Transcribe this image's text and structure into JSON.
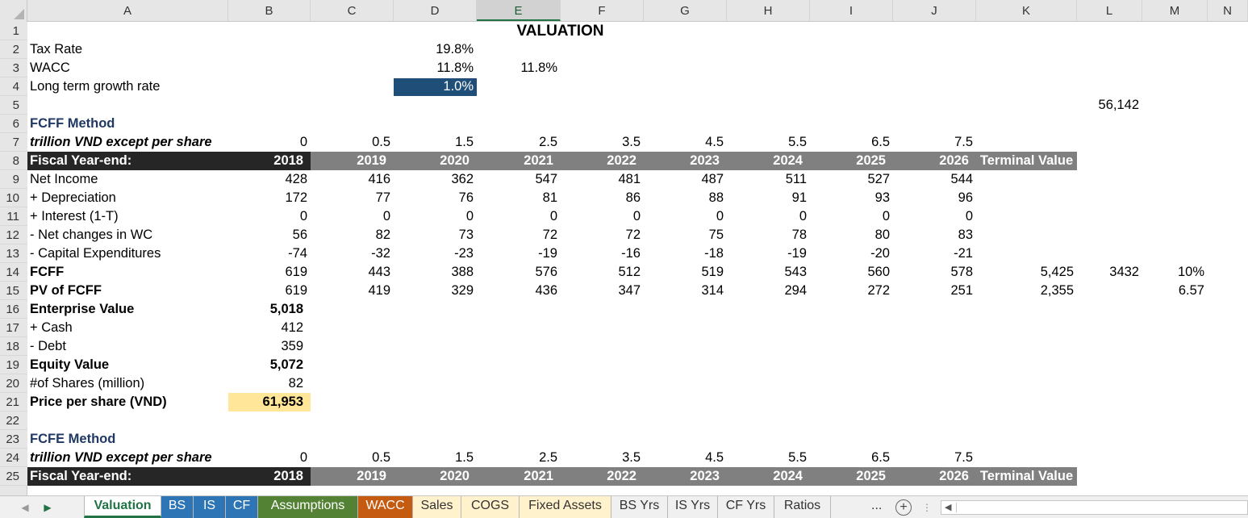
{
  "columns": [
    "A",
    "B",
    "C",
    "D",
    "E",
    "F",
    "G",
    "H",
    "I",
    "J",
    "K",
    "L",
    "M",
    "N"
  ],
  "selected_column": "E",
  "rows": [
    "1",
    "2",
    "3",
    "4",
    "5",
    "6",
    "7",
    "8",
    "9",
    "10",
    "11",
    "12",
    "13",
    "14",
    "15",
    "16",
    "17",
    "18",
    "19",
    "20",
    "21",
    "22",
    "23",
    "24",
    "25"
  ],
  "title": "VALUATION",
  "inputs": {
    "tax_rate": {
      "label": "Tax Rate",
      "value": "19.8%"
    },
    "wacc": {
      "label": "WACC",
      "value": "11.8%",
      "value2": "11.8%"
    },
    "growth": {
      "label": "Long term growth rate",
      "value": "1.0%"
    },
    "l5_value": "56,142"
  },
  "fcff": {
    "heading": "FCFF Method",
    "units": "trillion VND except per share",
    "periods": [
      "0",
      "0.5",
      "1.5",
      "2.5",
      "3.5",
      "4.5",
      "5.5",
      "6.5",
      "7.5"
    ],
    "header_label": "Fiscal Year-end:",
    "years": [
      "2018",
      "2019",
      "2020",
      "2021",
      "2022",
      "2023",
      "2024",
      "2025",
      "2026"
    ],
    "terminal": "Terminal Value",
    "lines": [
      {
        "label": "Net Income",
        "bold": false,
        "values": [
          "428",
          "416",
          "362",
          "547",
          "481",
          "487",
          "511",
          "527",
          "544"
        ]
      },
      {
        "label": "+ Depreciation",
        "bold": false,
        "values": [
          "172",
          "77",
          "76",
          "81",
          "86",
          "88",
          "91",
          "93",
          "96"
        ]
      },
      {
        "label": "+ Interest (1-T)",
        "bold": false,
        "values": [
          "0",
          "0",
          "0",
          "0",
          "0",
          "0",
          "0",
          "0",
          "0"
        ]
      },
      {
        "label": "- Net changes in WC",
        "bold": false,
        "values": [
          "56",
          "82",
          "73",
          "72",
          "72",
          "75",
          "78",
          "80",
          "83"
        ]
      },
      {
        "label": "- Capital Expenditures",
        "bold": false,
        "values": [
          "-74",
          "-32",
          "-23",
          "-19",
          "-16",
          "-18",
          "-19",
          "-20",
          "-21"
        ]
      },
      {
        "label": "FCFF",
        "bold": true,
        "values": [
          "619",
          "443",
          "388",
          "576",
          "512",
          "519",
          "543",
          "560",
          "578"
        ],
        "k": "5,425",
        "l": "3432",
        "m": "10%"
      },
      {
        "label": "PV of FCFF",
        "bold": true,
        "values": [
          "619",
          "419",
          "329",
          "436",
          "347",
          "314",
          "294",
          "272",
          "251"
        ],
        "k": "2,355",
        "m": "6.57"
      }
    ],
    "summary": [
      {
        "label": "Enterprise Value",
        "bold": true,
        "value": "5,018"
      },
      {
        "label": "+ Cash",
        "bold": false,
        "value": "412"
      },
      {
        "label": "- Debt",
        "bold": false,
        "value": "359"
      },
      {
        "label": "Equity Value",
        "bold": true,
        "value": "5,072"
      },
      {
        "label": "#of Shares (million)",
        "bold": false,
        "value": "82"
      },
      {
        "label": "Price per share (VND)",
        "bold": true,
        "value": "61,953"
      }
    ]
  },
  "fcfe": {
    "heading": "FCFE Method",
    "units": "trillion VND except per share",
    "periods": [
      "0",
      "0.5",
      "1.5",
      "2.5",
      "3.5",
      "4.5",
      "5.5",
      "6.5",
      "7.5"
    ],
    "header_label": "Fiscal Year-end:",
    "years": [
      "2018",
      "2019",
      "2020",
      "2021",
      "2022",
      "2023",
      "2024",
      "2025",
      "2026"
    ],
    "terminal": "Terminal Value"
  },
  "tabs": [
    {
      "label": "Valuation",
      "style": "active"
    },
    {
      "label": "BS",
      "style": "t-blue"
    },
    {
      "label": "IS",
      "style": "t-blue"
    },
    {
      "label": "CF",
      "style": "t-blue"
    },
    {
      "label": "Assumptions",
      "style": "t-green"
    },
    {
      "label": "WACC",
      "style": "t-orange"
    },
    {
      "label": "Sales",
      "style": "t-cream"
    },
    {
      "label": "COGS",
      "style": "t-cream"
    },
    {
      "label": "Fixed Assets",
      "style": "t-cream"
    },
    {
      "label": "BS Yrs",
      "style": "t-plain"
    },
    {
      "label": "IS Yrs",
      "style": "t-plain"
    },
    {
      "label": "CF Yrs",
      "style": "t-plain"
    },
    {
      "label": "Ratios",
      "style": "t-plain"
    }
  ],
  "more_tabs": "...",
  "icons": {
    "prev": "triangle-left",
    "next": "triangle-right",
    "add": "plus-circle",
    "options": "vertical-ellipsis",
    "scroll_left": "triangle-left"
  }
}
